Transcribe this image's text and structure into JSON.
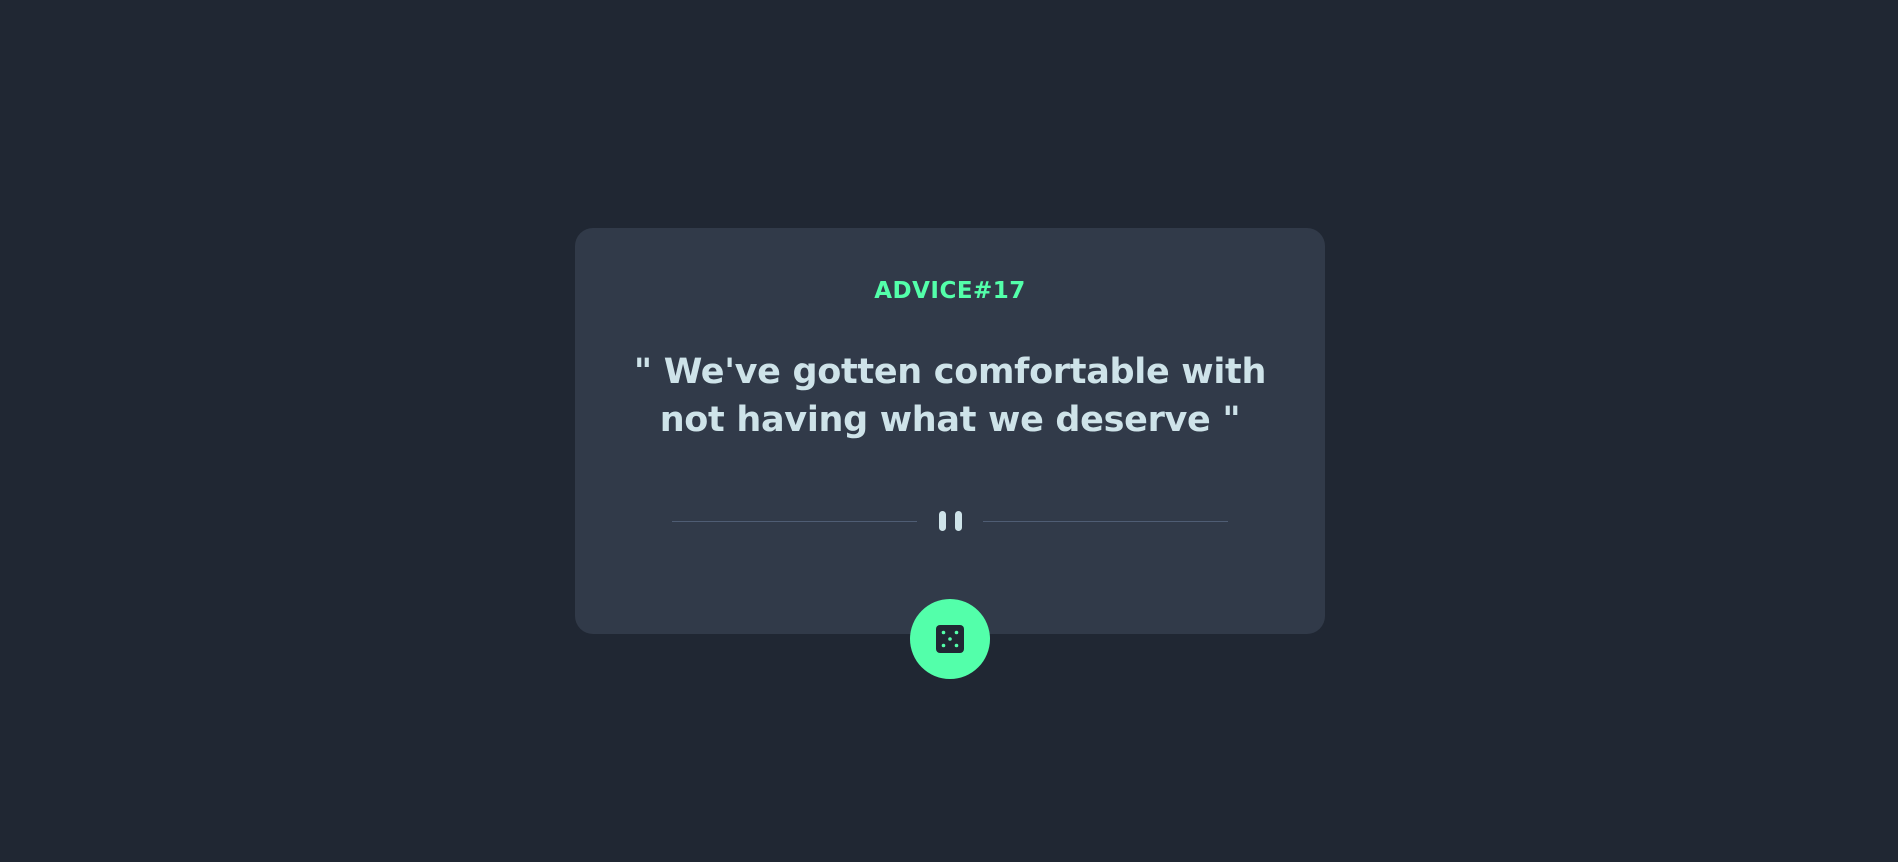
{
  "advice": {
    "id_label": "ADVICE#17",
    "quote_text": "\" We've gotten comfortable with not having what we deserve \""
  },
  "divider": {
    "icon": "pause-icon"
  },
  "dice_button": {
    "icon": "dice-icon"
  },
  "colors": {
    "background": "#202733",
    "card": "#313a49",
    "accent": "#53ffaa",
    "text": "#cee3e9",
    "divider_line": "#4f5d74"
  }
}
